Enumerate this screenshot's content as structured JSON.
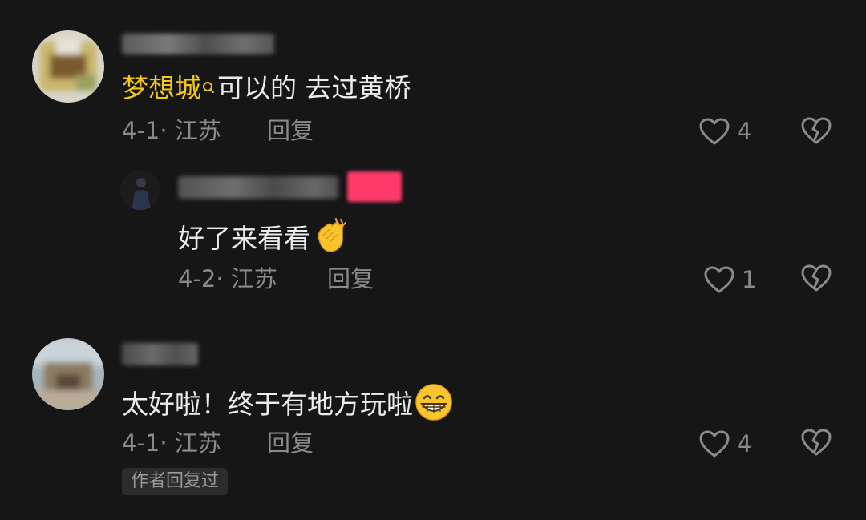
{
  "comments": [
    {
      "mention": "梦想城",
      "text": "可以的 去过黄桥",
      "date": "4-1",
      "location": "江苏",
      "reply_label": "回复",
      "likes": "4",
      "reply": {
        "text": "好了来看看",
        "emoji": "clapping-hands",
        "date": "4-2",
        "location": "江苏",
        "reply_label": "回复",
        "likes": "1"
      }
    },
    {
      "text": "太好啦！终于有地方玩啦",
      "emoji": "grinning-face",
      "date": "4-1",
      "location": "江苏",
      "reply_label": "回复",
      "likes": "4",
      "badge": "作者回复过"
    }
  ],
  "colors": {
    "background": "#161616",
    "mention": "#f4c81e",
    "muted": "#8a8a8a",
    "author_tag": "#ff3a6a"
  }
}
